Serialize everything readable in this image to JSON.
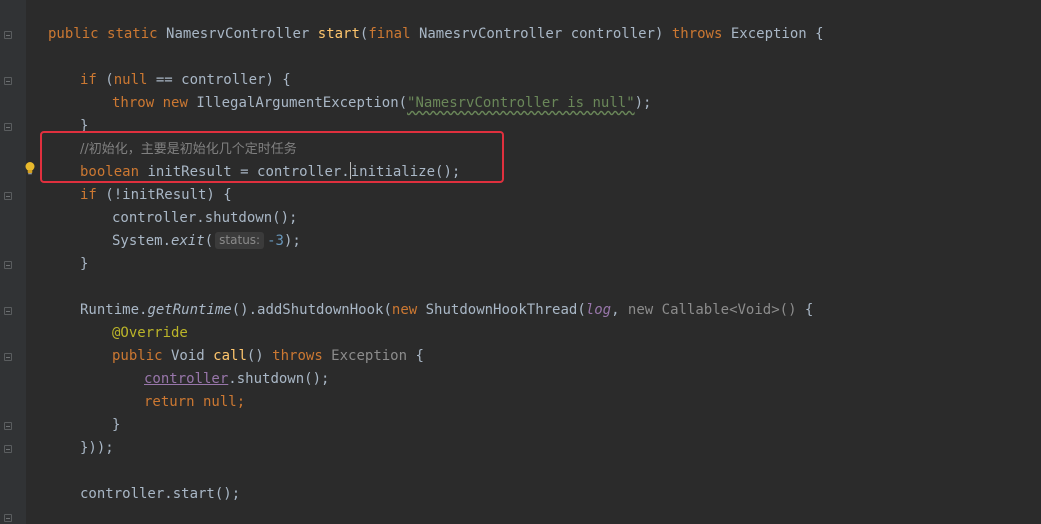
{
  "editor": {
    "signature": {
      "mod1": "public",
      "mod2": "static",
      "return_type": "NamesrvController",
      "method": "start",
      "param_mod": "final",
      "param_type": "NamesrvController",
      "param_name": "controller",
      "throws": "throws",
      "exception": "Exception"
    },
    "if1": {
      "kw": "if",
      "cond_null": "null",
      "rest": " == controller) {"
    },
    "throw_line": {
      "kw_throw": "throw",
      "kw_new": "new",
      "cls": "IllegalArgumentException(",
      "str": "\"NamesrvController is null\"",
      "tail": ");"
    },
    "close1": "}",
    "comment": "//初始化，主要是初始化几个定时任务",
    "init_line": {
      "kw": "boolean",
      "before_caret": " initResult = controller.",
      "after_caret": "initialize();"
    },
    "if2": {
      "kw": "if",
      "rest": " (!initResult) {"
    },
    "shutdown_line": "controller.shutdown();",
    "exit_line": {
      "prefix": "System.",
      "method": "exit",
      "open": "(",
      "hint": "status:",
      "num": "-3",
      "close": ");"
    },
    "close2": "}",
    "hook_line": {
      "p1": "Runtime.",
      "method": "getRuntime",
      "p2": "().addShutdownHook(",
      "kw_new": "new",
      "cls": " ShutdownHookThread(",
      "field": "log",
      "comma": ", ",
      "gray": "new Callable<Void>()",
      "tail": " {"
    },
    "override": "@Override",
    "call_line": {
      "kw_public": "public",
      "type": " Void ",
      "method": "call",
      "paren": "() ",
      "throws": "throws",
      "exception": " Exception",
      "tail": " {"
    },
    "inner_shutdown": {
      "field": "controller",
      "rest": ".shutdown();"
    },
    "return_line": {
      "kw": "return",
      "kw_null": " null",
      "tail": ";"
    },
    "close3": "}",
    "close4": "}));",
    "start_line": "controller.start();"
  },
  "colors": {
    "background": "#2b2b2b",
    "gutter": "#313335",
    "keyword": "#cc7832",
    "method_decl": "#ffc66d",
    "string": "#6a8759",
    "comment": "#808080",
    "annotation": "#bbb529",
    "field": "#9876aa",
    "number": "#6897bb",
    "plain": "#a9b7c6",
    "highlight_box": "#e0303e"
  },
  "icons": [
    "fold-marker-icon",
    "lightbulb-icon"
  ]
}
